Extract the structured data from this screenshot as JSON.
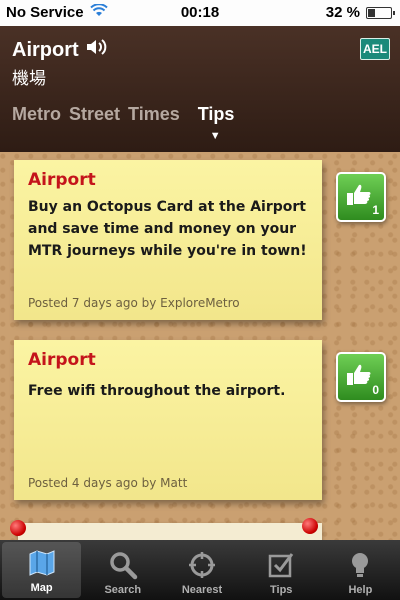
{
  "status_bar": {
    "carrier": "No Service",
    "time": "00:18",
    "battery": "32 %",
    "battery_level": 0.32
  },
  "header": {
    "station_name": "Airport",
    "station_name_chinese": "機場",
    "line_badge": "AEL",
    "line_color": "#1b8a7a",
    "tabs": [
      {
        "label": "Metro"
      },
      {
        "label": "Street"
      },
      {
        "label": "Times"
      },
      {
        "label": "Tips"
      }
    ],
    "active_tab": "Tips"
  },
  "tips": [
    {
      "title": "Airport",
      "body": "Buy an Octopus Card at the Airport and save time and money on your MTR journeys while you're in town!",
      "meta": "Posted 7 days ago by ExploreMetro",
      "votes": "1"
    },
    {
      "title": "Airport",
      "body": "Free wifi throughout the airport.",
      "meta": "Posted 4 days ago by Matt",
      "votes": "0"
    }
  ],
  "tabbar": {
    "items": [
      {
        "label": "Map",
        "icon": "map-icon"
      },
      {
        "label": "Search",
        "icon": "search-icon"
      },
      {
        "label": "Nearest",
        "icon": "crosshair-icon"
      },
      {
        "label": "Tips",
        "icon": "checklist-icon"
      },
      {
        "label": "Help",
        "icon": "lightbulb-icon"
      }
    ],
    "active": "Map"
  },
  "colors": {
    "note_title": "#c4141b",
    "vote_green": "#2f8c1f",
    "header_brown": "#2e1c14"
  }
}
